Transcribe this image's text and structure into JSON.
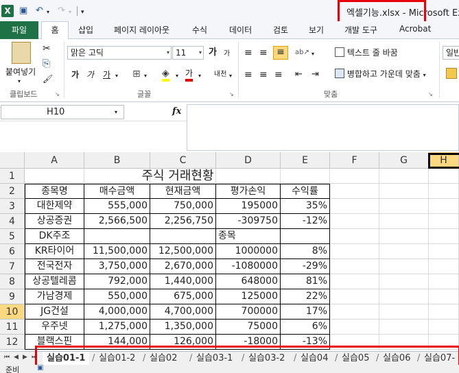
{
  "titlebar": {
    "app_icon_letter": "X",
    "window_title": "엑셀기능.xlsx  -  Microsoft Ex",
    "icons": [
      "excel-app-icon",
      "save-icon",
      "undo-icon",
      "redo-icon",
      "customize-qa-icon"
    ],
    "glyphs": {
      "save": "▣",
      "undo": "↶",
      "redo": "↷",
      "dd": "▾",
      "customize": "▾"
    }
  },
  "ribbon_tabs": [
    "파일",
    "홈",
    "삽입",
    "페이지 레이아웃",
    "수식",
    "데이터",
    "검토",
    "보기",
    "개발 도구",
    "Acrobat"
  ],
  "clipboard": {
    "paste_label": "붙여넣기",
    "paste_dd": "▾",
    "group_label": "클립보드",
    "launcher": "↘",
    "cut": "✂",
    "copy": "⎘",
    "format_painter": "🖌"
  },
  "font": {
    "font_name": "맑은 고딕",
    "font_size": "11",
    "dd": "▾",
    "grow": "가",
    "shrink": "가",
    "bold": "가",
    "italic": "가",
    "underline": "가",
    "underline_dd": "▾",
    "border": "⊞",
    "border_dd": "▾",
    "fill": "◈",
    "fill_dd": "▾",
    "color": "가",
    "color_dd": "▾",
    "phonetic": "내천",
    "phonetic_dd": "▾",
    "group_label": "글꼴",
    "launcher": "↘"
  },
  "alignment": {
    "align_top": "≡",
    "align_middle": "≡",
    "align_bottom": "≡",
    "orientation": "ab↗",
    "orientation_dd": "▾",
    "align_left": "≡",
    "align_center": "≡",
    "align_right": "≡",
    "decrease_indent": "⇤",
    "increase_indent": "⇥",
    "wrap_text": "텍스트 줄 바꿈",
    "merge_center": "병합하고 가운데 맞춤",
    "merge_dd": "▾",
    "group_label": "맞춤",
    "launcher": "↘"
  },
  "number": {
    "format": "일반"
  },
  "formula_bar": {
    "name_box": "H10",
    "name_dd": "▾",
    "fx": "fx",
    "formula": ""
  },
  "columns": [
    "A",
    "B",
    "C",
    "D",
    "E",
    "F",
    "G",
    "H"
  ],
  "rows": [
    "1",
    "2",
    "3",
    "4",
    "5",
    "6",
    "7",
    "8",
    "9",
    "10",
    "11",
    "12"
  ],
  "sheet": {
    "title": "주식 거래현황",
    "headers": [
      "종목명",
      "매수금액",
      "현재금액",
      "평가손익",
      "수익률"
    ],
    "data": [
      [
        "대한제약",
        "555,000",
        "750,000",
        "195000",
        "35%"
      ],
      [
        "상공증권",
        "2,566,500",
        "2,256,750",
        "-309750",
        "-12%"
      ],
      [
        "DK주조",
        "",
        "",
        "종목",
        ""
      ],
      [
        "KR타이어",
        "11,500,000",
        "12,500,000",
        "1000000",
        "8%"
      ],
      [
        "전국전자",
        "3,750,000",
        "2,670,000",
        "-1080000",
        "-29%"
      ],
      [
        "상공텔레콤",
        "792,000",
        "1,440,000",
        "648000",
        "81%"
      ],
      [
        "가남경제",
        "550,000",
        "675,000",
        "125000",
        "22%"
      ],
      [
        "JG건설",
        "4,000,000",
        "4,700,000",
        "700000",
        "17%"
      ],
      [
        "우주넷",
        "1,275,000",
        "1,350,000",
        "75000",
        "6%"
      ],
      [
        "블랙스핀",
        "144,000",
        "126,000",
        "-18000",
        "-13%"
      ]
    ]
  },
  "sheet_nav": [
    "⏮",
    "◀",
    "▶",
    "⏭"
  ],
  "sheet_tabs": [
    "실습01-1",
    "실습01-2",
    "실습02",
    "실습03-1",
    "실습03-2",
    "실습04",
    "실습05",
    "실습06",
    "실습07-"
  ],
  "status": {
    "text": "준비",
    "macro_icon": "▣"
  }
}
